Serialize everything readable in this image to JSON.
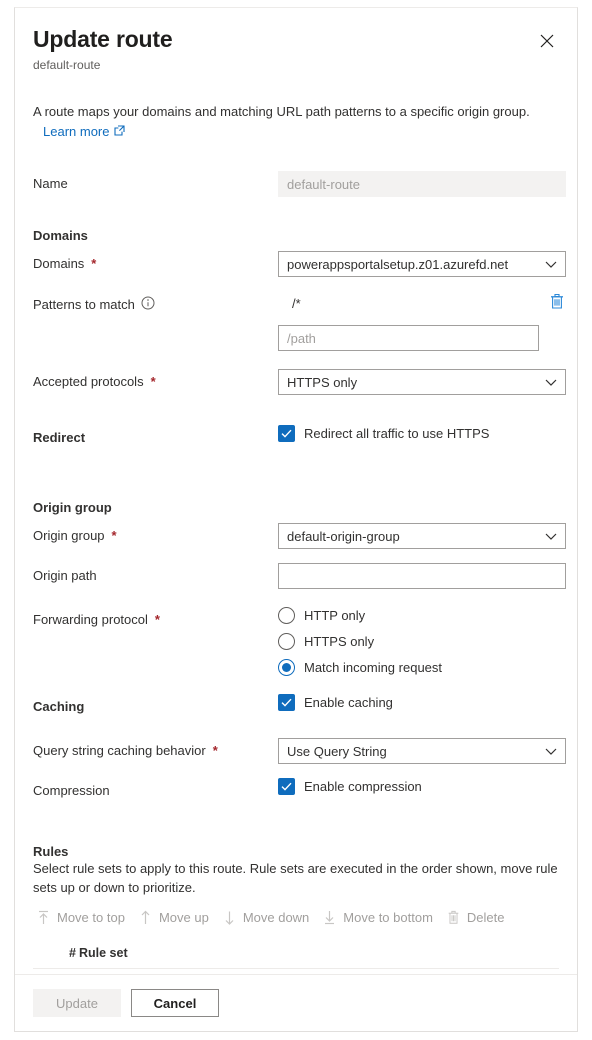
{
  "dialog": {
    "title": "Update route",
    "subtitle": "default-route",
    "close_label": "Close",
    "intro_text": "A route maps your domains and matching URL path patterns to a specific origin group.",
    "learn_more_label": "Learn more"
  },
  "fields": {
    "name": {
      "label": "Name",
      "value": "default-route"
    },
    "domains_section": {
      "heading": "Domains",
      "label": "Domains",
      "required": "*",
      "value": "powerappsportalsetup.z01.azurefd.net"
    },
    "patterns": {
      "label": "Patterns to match",
      "info_icon": "info-icon",
      "value": "/*",
      "delete_icon": "trash-icon",
      "input_value": "",
      "input_placeholder": "/path"
    },
    "accepted_protocols": {
      "label": "Accepted protocols",
      "required": "*",
      "value": "HTTPS only"
    },
    "redirect": {
      "label": "Redirect",
      "checkbox_label": "Redirect all traffic to use HTTPS",
      "checked": true
    },
    "origin_group_section": {
      "heading": "Origin group",
      "label": "Origin group",
      "required": "*",
      "value": "default-origin-group"
    },
    "origin_path": {
      "label": "Origin path",
      "value": "",
      "placeholder": ""
    },
    "forwarding_protocol": {
      "label": "Forwarding protocol",
      "required": "*",
      "options": [
        {
          "label": "HTTP only",
          "checked": false
        },
        {
          "label": "HTTPS only",
          "checked": false
        },
        {
          "label": "Match incoming request",
          "checked": true
        }
      ]
    },
    "caching": {
      "label": "Caching",
      "checkbox_label": "Enable caching",
      "checked": true
    },
    "query_string_caching": {
      "label": "Query string caching behavior",
      "required": "*",
      "value": "Use Query String"
    },
    "compression": {
      "label": "Compression",
      "checkbox_label": "Enable compression",
      "checked": true
    }
  },
  "rules": {
    "heading": "Rules",
    "description": "Select rule sets to apply to this route. Rule sets are executed in the order shown, move rule sets up or down to prioritize.",
    "commands": [
      {
        "label": "Move to top",
        "icon": "arrow-up-to-line-icon",
        "disabled": true
      },
      {
        "label": "Move up",
        "icon": "arrow-up-icon",
        "disabled": true
      },
      {
        "label": "Move down",
        "icon": "arrow-down-icon",
        "disabled": true
      },
      {
        "label": "Move to bottom",
        "icon": "arrow-down-to-line-icon",
        "disabled": true
      },
      {
        "label": "Delete",
        "icon": "trash-icon",
        "disabled": true
      }
    ],
    "columns": [
      "#",
      "Rule set"
    ],
    "rows": []
  },
  "footer": {
    "update_label": "Update",
    "cancel_label": "Cancel"
  },
  "colors": {
    "accent": "#0f6cbd",
    "required": "#a4262c",
    "disabled_text": "#a19f9d",
    "border": "#a19f9d",
    "panel_border": "#e1dfdd"
  }
}
